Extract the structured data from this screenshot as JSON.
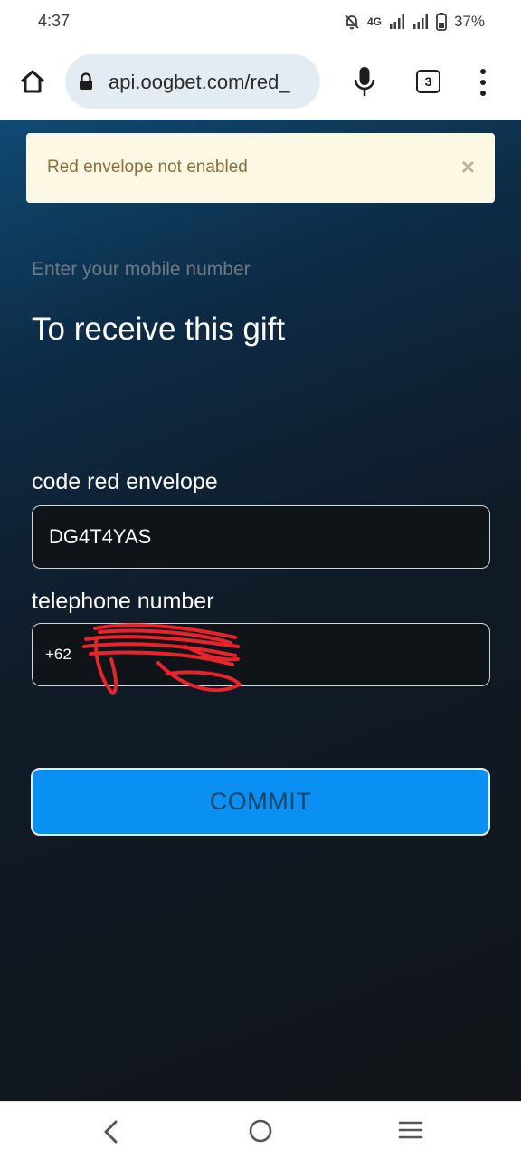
{
  "status_bar": {
    "time": "4:37",
    "network": "4G",
    "battery": "37%",
    "icons": [
      "bell-off-icon",
      "signal-icon",
      "battery-icon"
    ]
  },
  "browser": {
    "url": "api.oogbet.com/red_",
    "tab_count": "3",
    "icons": [
      "home-icon",
      "lock-icon",
      "mic-icon",
      "tabs-icon",
      "more-vert-icon"
    ]
  },
  "alert": {
    "message": "Red envelope not enabled",
    "close": "×"
  },
  "form": {
    "hint": "Enter your mobile number",
    "heading": "To receive this gift",
    "code_label": "code red envelope",
    "code_value": "DG4T4YAS",
    "phone_label": "telephone number",
    "phone_value": "+62",
    "commit_label": "COMMIT"
  },
  "nav": {
    "icons": [
      "back-icon",
      "home-circle-icon",
      "recent-apps-icon"
    ]
  },
  "colors": {
    "commit_button": "#0a8ff2",
    "alert_background": "#fcf8e3",
    "alert_text": "#8a6d3b",
    "scribble": "#e8232b"
  }
}
